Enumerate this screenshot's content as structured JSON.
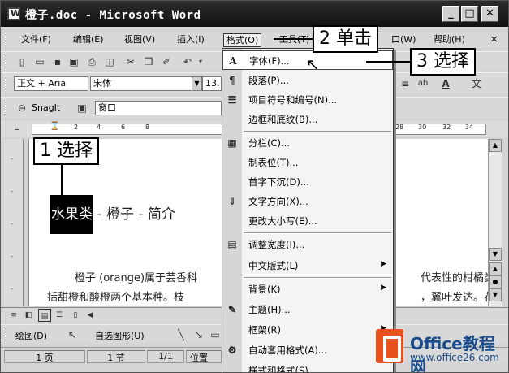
{
  "window": {
    "title": "橙子.doc - Microsoft Word",
    "minimize_glyph": "_",
    "maximize_glyph": "□",
    "close_glyph": "✕"
  },
  "menubar": {
    "items": [
      "文件(F)",
      "编辑(E)",
      "视图(V)",
      "插入(I)",
      "格式(O)",
      "工具(T)",
      "口(W)",
      "帮助(H)"
    ],
    "close_doc_glyph": "✕"
  },
  "formatting_toolbar": {
    "style_value": "正文 + Aria",
    "font_value": "宋体",
    "size_value": "13."
  },
  "snagit_toolbar": {
    "label": "SnagIt",
    "window_value": "窗口"
  },
  "ruler": {
    "numbers": [
      "2",
      "4",
      "6",
      "8",
      "28",
      "30",
      "32",
      "34"
    ]
  },
  "document": {
    "heading_selected": "水果类",
    "heading_rest": " - 橙子 - 简介",
    "para1": "橙子 (orange)属于芸香科",
    "para1_right": "代表性的柑橘类",
    "para2": "括甜橙和酸橙两个基本种。枝",
    "para2_right": "，翼叶发达。花"
  },
  "format_menu": {
    "items": [
      {
        "icon": "A",
        "label": "字体(F)...",
        "submenu": false
      },
      {
        "icon": "¶",
        "label": "段落(P)...",
        "submenu": false
      },
      {
        "icon": "☰",
        "label": "项目符号和编号(N)...",
        "submenu": false
      },
      {
        "icon": "",
        "label": "边框和底纹(B)...",
        "submenu": false
      },
      {
        "icon": "▦",
        "label": "分栏(C)...",
        "submenu": false
      },
      {
        "icon": "",
        "label": "制表位(T)...",
        "submenu": false
      },
      {
        "icon": "",
        "label": "首字下沉(D)...",
        "submenu": false
      },
      {
        "icon": "⇓",
        "label": "文字方向(X)...",
        "submenu": false
      },
      {
        "icon": "",
        "label": "更改大小写(E)...",
        "submenu": false
      },
      {
        "icon": "▤",
        "label": "调整宽度(I)...",
        "submenu": false
      },
      {
        "icon": "",
        "label": "中文版式(L)",
        "submenu": true
      },
      {
        "icon": "",
        "label": "背景(K)",
        "submenu": true
      },
      {
        "icon": "✎",
        "label": "主题(H)...",
        "submenu": false
      },
      {
        "icon": "",
        "label": "框架(R)",
        "submenu": true
      },
      {
        "icon": "⚙",
        "label": "自动套用格式(A)...",
        "submenu": false
      },
      {
        "icon": "",
        "label": "样式和格式(S)...",
        "submenu": false
      }
    ],
    "submenu_glyph": "▶"
  },
  "callouts": {
    "step1": "1 选择",
    "step2": "2 单击",
    "step3": "3 选择"
  },
  "drawing_toolbar": {
    "draw_label": "绘图(D)",
    "autoshape_label": "自选图形(U)"
  },
  "statusbar": {
    "page": "1 页",
    "section": "1 节",
    "pages": "1/1",
    "position": "位置"
  },
  "logo": {
    "name": "Office教程网",
    "url": "www.office26.com"
  },
  "colors": {
    "logo_orange": "#e8501c",
    "logo_blue": "#1a4c8c"
  }
}
